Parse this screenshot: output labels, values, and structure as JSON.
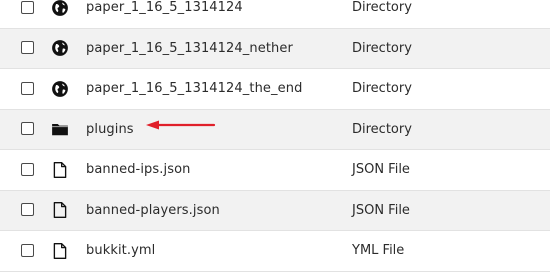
{
  "file_list": {
    "rows": [
      {
        "name": "paper_1_16_5_1314124",
        "type": "Directory",
        "icon": "globe-icon"
      },
      {
        "name": "paper_1_16_5_1314124_nether",
        "type": "Directory",
        "icon": "globe-icon"
      },
      {
        "name": "paper_1_16_5_1314124_the_end",
        "type": "Directory",
        "icon": "globe-icon"
      },
      {
        "name": "plugins",
        "type": "Directory",
        "icon": "folder-icon"
      },
      {
        "name": "banned-ips.json",
        "type": "JSON File",
        "icon": "file-icon"
      },
      {
        "name": "banned-players.json",
        "type": "JSON File",
        "icon": "file-icon"
      },
      {
        "name": "bukkit.yml",
        "type": "YML File",
        "icon": "file-icon"
      }
    ]
  },
  "annotation": {
    "arrow_color": "#e0202a",
    "points_to": "plugins"
  }
}
